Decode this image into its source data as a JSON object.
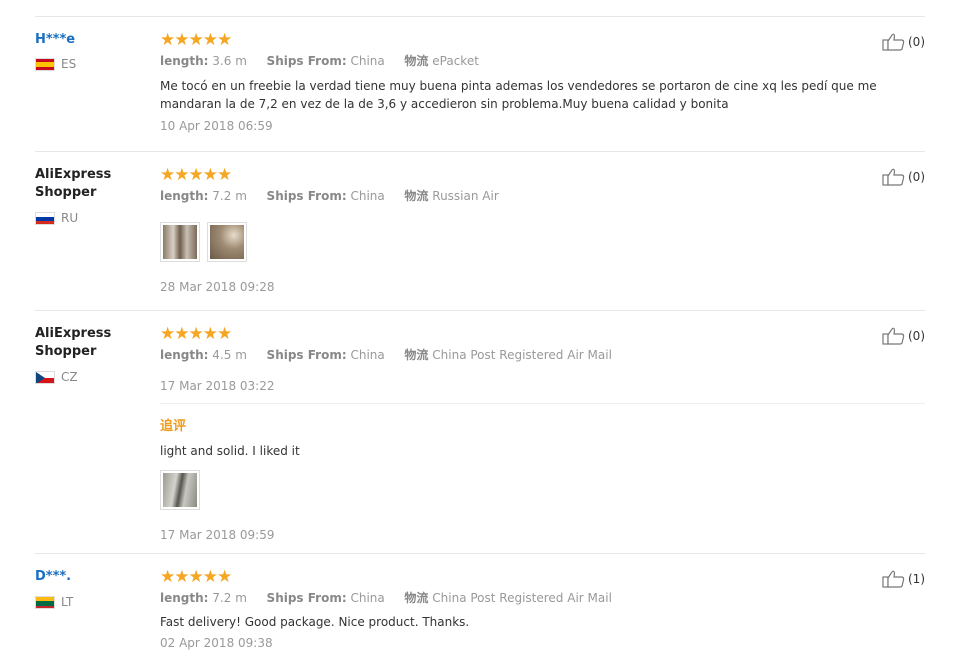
{
  "reviews": [
    {
      "user": "H***e",
      "country": "ES",
      "rating_stars": "★★★★★",
      "meta": {
        "length_label": "length:",
        "length": "3.6 m",
        "ships_label": "Ships From:",
        "ships": "China",
        "logistics_label": "物流",
        "logistics": "ePacket"
      },
      "text_line1": "Me tocó en un freebie la verdad tiene muy buena pinta ademas los vendedores se portaron de cine xq les pedí que me",
      "text_line2": "mandaran la de 7,2 en vez de la de 3,6 y accedieron sin problema.Muy buena calidad y bonita",
      "date": "10 Apr 2018 06:59",
      "likes": "(0)"
    },
    {
      "user_line1": "AliExpress",
      "user_line2": "Shopper",
      "country": "RU",
      "rating_stars": "★★★★★",
      "meta": {
        "length_label": "length:",
        "length": "7.2 m",
        "ships_label": "Ships From:",
        "ships": "China",
        "logistics_label": "物流",
        "logistics": "Russian Air"
      },
      "date": "28 Mar 2018 09:28",
      "likes": "(0)"
    },
    {
      "user_line1": "AliExpress",
      "user_line2": "Shopper",
      "country": "CZ",
      "rating_stars": "★★★★★",
      "meta": {
        "length_label": "length:",
        "length": "4.5 m",
        "ships_label": "Ships From:",
        "ships": "China",
        "logistics_label": "物流",
        "logistics": "China Post Registered Air Mail"
      },
      "date": "17 Mar 2018 03:22",
      "followup_title": "追评",
      "followup_text": "light and solid. I liked it",
      "followup_date": "17 Mar 2018 09:59",
      "likes": "(0)"
    },
    {
      "user": "D***.",
      "country": "LT",
      "rating_stars": "★★★★★",
      "meta": {
        "length_label": "length:",
        "length": "7.2 m",
        "ships_label": "Ships From:",
        "ships": "China",
        "logistics_label": "物流",
        "logistics": "China Post Registered Air Mail"
      },
      "text_line1": "Fast delivery! Good package. Nice product. Thanks.",
      "date": "02 Apr 2018 09:38",
      "likes": "(1)"
    }
  ],
  "colors": {
    "star": "#f5a623",
    "link": "#1a6fc1",
    "followup": "#f09b1a"
  },
  "icons": {
    "like": "thumbs-up-icon"
  }
}
